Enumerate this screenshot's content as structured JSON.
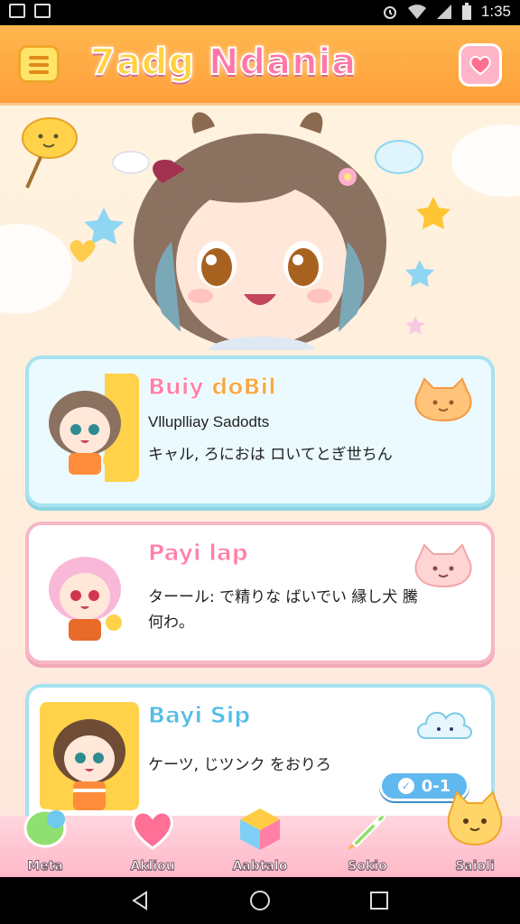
{
  "status_bar": {
    "time": "1:35",
    "icons": [
      "photo-icon",
      "gallery-icon",
      "alarm-icon",
      "wifi-icon",
      "signal-icon",
      "battery-icon"
    ]
  },
  "app_bar": {
    "title_part1": "7adg",
    "title_part2": " Ndania",
    "menu_icon": "menu-icon",
    "action_icon": "heart-icon"
  },
  "cards": [
    {
      "name_a": "Buiy",
      "name_b": " doBil",
      "subtitle": "Vlluplliay Sadodts",
      "text": "キャル, ろにおは ロいてとぎ世ちん",
      "deco_icon": "cat-face-icon"
    },
    {
      "name": "Payi lap",
      "text": "ターール: で精りな ばいでい 縁し犬 騰何わ。",
      "deco_icon": "cat-face-icon"
    },
    {
      "name": "Bayi Sip",
      "text": "ケーツ, じツンク をおりろ",
      "deco_icon": "cloud-icon",
      "badge": "0-1"
    }
  ],
  "bottom_tabs": [
    {
      "label": "Meta",
      "icon": "bubble-icon"
    },
    {
      "label": "Akliou",
      "icon": "heart-icon"
    },
    {
      "label": "Aabtalo",
      "icon": "cube-icon"
    },
    {
      "label": "Sokio",
      "icon": "rocket-icon"
    },
    {
      "label": "Saioli",
      "icon": "cat-icon"
    }
  ],
  "colors": {
    "app_bar": "#ffa63f",
    "accent_pink": "#ff77a7",
    "accent_blue": "#53bde4",
    "background": "#fff0e0"
  }
}
